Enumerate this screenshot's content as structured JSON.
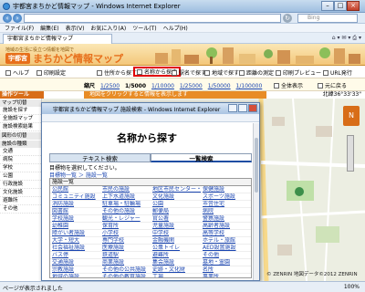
{
  "window": {
    "title": "宇都宮まちかど情報マップ - Windows Internet Explorer",
    "search_placeholder": "Bing"
  },
  "menubar": [
    "ファイル(F)",
    "編集(E)",
    "表示(V)",
    "お気に入り(A)",
    "ツール(T)",
    "ヘルプ(H)"
  ],
  "tab": {
    "label": "宇都宮まちかど情報マップ"
  },
  "header": {
    "tagline": "地域の生活に役立つ情報を地図で",
    "badge": "宇都宮",
    "site_name": "まちかど情報マップ"
  },
  "toolbar1": {
    "help": "ヘルプ",
    "print": "印刷設定",
    "back": "住所から探す",
    "name_search": "名称から探す",
    "station": "駅名で探す",
    "area": "地域で探す",
    "measure": "距離の測定",
    "preview": "印刷プレビュー",
    "url": "URL発行"
  },
  "toolbar2": {
    "scale_label": "縮尺",
    "scales": [
      "1/2500",
      "1/5000",
      "1/10000",
      "1/25000",
      "1/50000",
      "1/100000"
    ],
    "current_scale": "1/5000",
    "link1": "全体表示",
    "link2": "元に戻る"
  },
  "notice": "地図をクリックすると情報を表示します",
  "coord": "北緯36°33'33\"",
  "sidebar": {
    "heading": "操作ツール",
    "items": [
      "マップ切替",
      "施設を探す",
      "全施設マップ",
      "施設検索結果",
      "図形の切替",
      "施設の種類",
      "交通",
      "病院",
      "学校",
      "公園",
      "行政施設",
      "文化施設",
      "避難所",
      "その他"
    ]
  },
  "popup": {
    "title": "宇都宮まちかど情報マップ 施設検索 - Windows Internet Explorer",
    "heading": "名称から探す",
    "tab_text": "テキスト検索",
    "tab_list": "一覧検索",
    "select_msg": "目標物を選択してください。",
    "breadcrumb": "目標物一覧 ＞ 施設一覧",
    "category_header": "施設一覧",
    "categories": [
      "公民館",
      "市民の施設",
      "地区市民センター・出張所",
      "保健施設",
      "コミュニティ施設",
      "上下水道施設",
      "文化施設",
      "スポーツ施設",
      "消防施設",
      "駐車場・駐輪場",
      "公園",
      "市営住宅",
      "図書館",
      "その他の施設",
      "郵便局",
      "病院",
      "学校施設",
      "観光・レジャー",
      "官公署",
      "警察施設",
      "幼稚園",
      "保育所",
      "児童施設",
      "高齢者施設",
      "障がい者施設",
      "小学校",
      "中学校",
      "高等学校",
      "大学・短大",
      "専門学校",
      "金融機関",
      "ホテル・旅館",
      "社会福祉施設",
      "医療施設",
      "公衆トイレ",
      "AED設置施設",
      "バス停",
      "鉄道駅",
      "避難所",
      "その他",
      "交通施設",
      "商業施設",
      "集会施設",
      "墓地・霊園",
      "宗教施設",
      "その他の公共施設",
      "史跡・文化財",
      "名所",
      "地域の施設",
      "その他の教育施設",
      "工場",
      "事業所"
    ]
  },
  "map": {
    "compass": "N",
    "copyright": "© ZENRIN 地図データ©2012 ZENRIN"
  },
  "status": {
    "text": "ページが表示されました",
    "zoom": "100%"
  }
}
